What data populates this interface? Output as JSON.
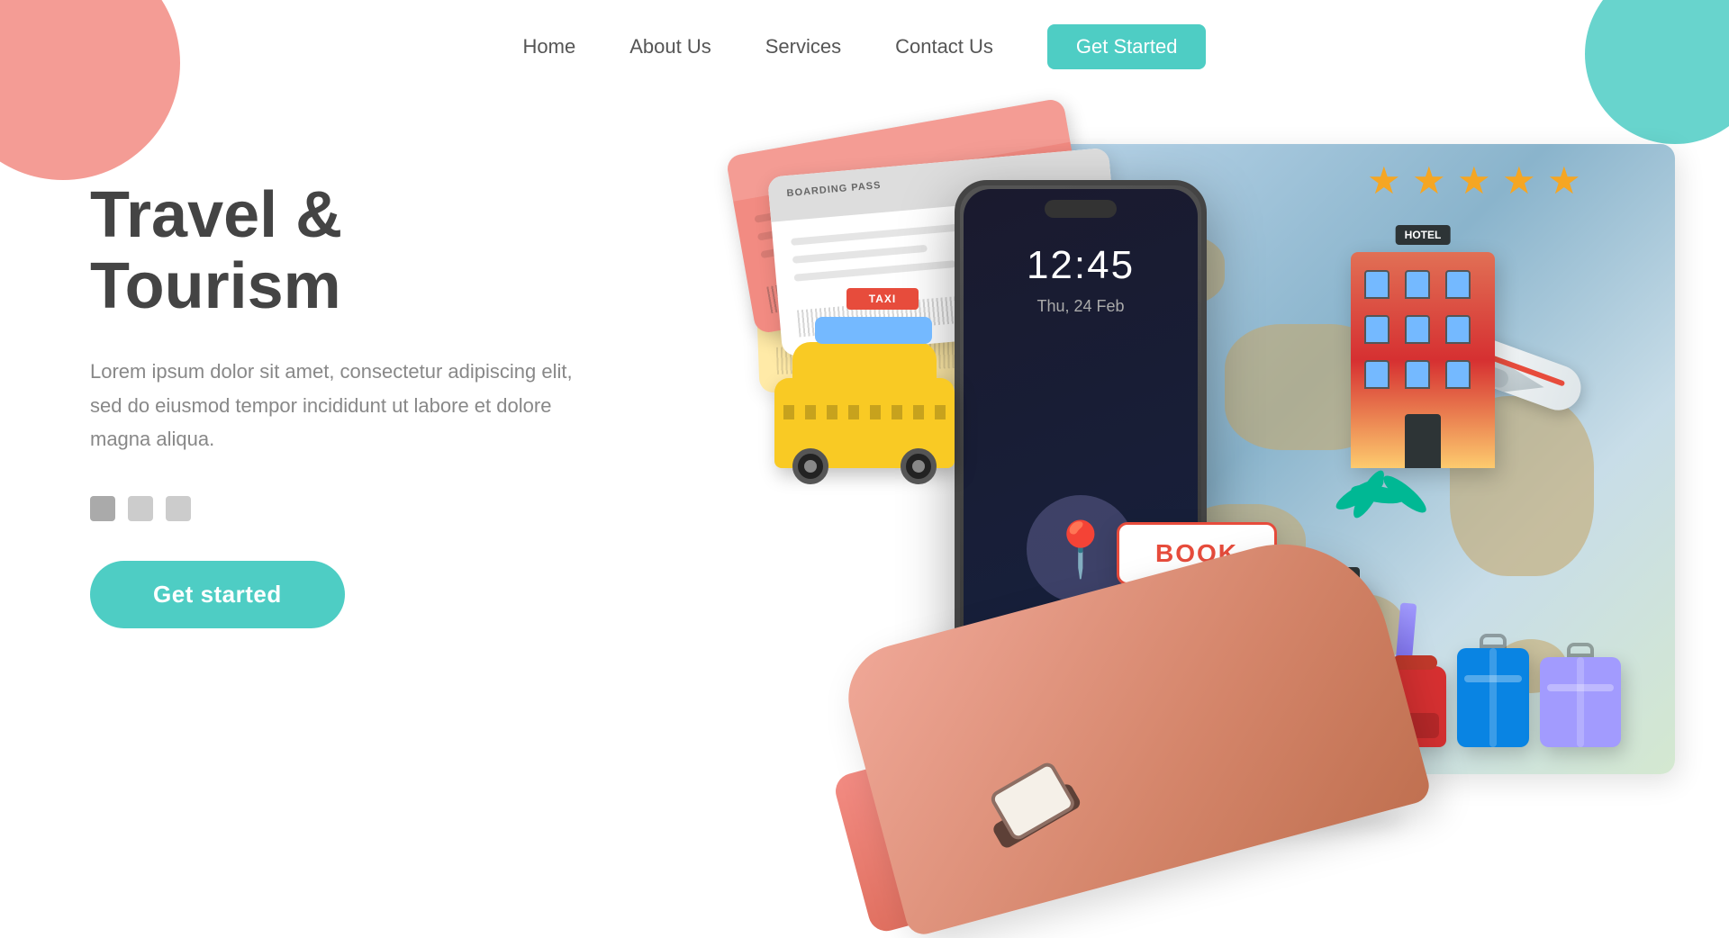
{
  "nav": {
    "links": [
      {
        "label": "Home",
        "id": "home"
      },
      {
        "label": "About Us",
        "id": "about"
      },
      {
        "label": "Services",
        "id": "services"
      },
      {
        "label": "Contact Us",
        "id": "contact"
      }
    ],
    "cta_label": "Get Started"
  },
  "hero": {
    "title": "Travel & Tourism",
    "description": "Lorem ipsum dolor sit amet, consectetur adipiscing elit, sed do eiusmod tempor incididunt ut labore et dolore magna aliqua.",
    "cta_label": "Get started"
  },
  "phone": {
    "time": "12:45",
    "boarding_pass_label": "BOARDING PASS"
  },
  "book_button": {
    "label": "BOOK"
  },
  "taxi": {
    "sign": "TAXI"
  },
  "stars": {
    "count": 5,
    "symbol": "★"
  }
}
